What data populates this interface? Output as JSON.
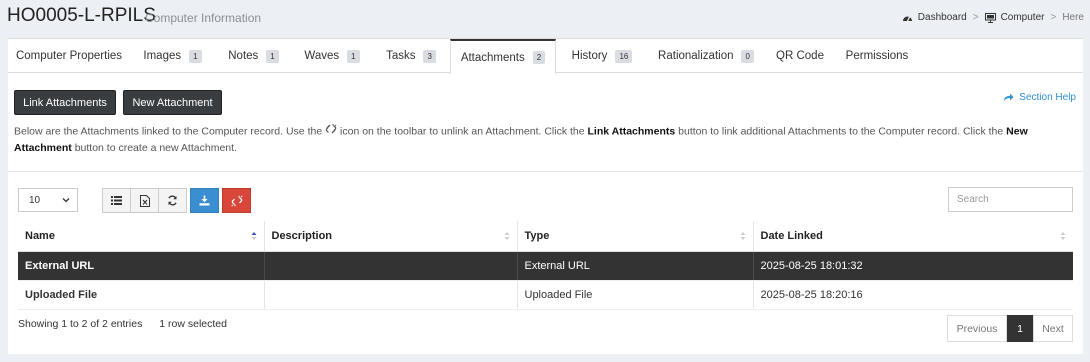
{
  "header": {
    "title": "HO0005-L-RPILS",
    "subtitle": "Computer Information",
    "breadcrumb": {
      "dashboard": "Dashboard",
      "computer": "Computer",
      "here": "Here"
    }
  },
  "tabs": [
    {
      "label": "Computer Properties",
      "count": null
    },
    {
      "label": "Images",
      "count": "1"
    },
    {
      "label": "Notes",
      "count": "1"
    },
    {
      "label": "Waves",
      "count": "1"
    },
    {
      "label": "Tasks",
      "count": "3"
    },
    {
      "label": "Attachments",
      "count": "2",
      "active": true
    },
    {
      "label": "History",
      "count": "16"
    },
    {
      "label": "Rationalization",
      "count": "0"
    },
    {
      "label": "QR Code",
      "count": null
    },
    {
      "label": "Permissions",
      "count": null
    }
  ],
  "actions": {
    "link": "Link Attachments",
    "new": "New Attachment",
    "help": "Section Help"
  },
  "intro": {
    "p1": "Below are the Attachments linked to the Computer record. Use the",
    "p2": "icon on the toolbar to unlink an Attachment. Click the",
    "b1": "Link Attachments",
    "p3": "button to link additional Attachments to the Computer record. Click the",
    "b2": "New Attachment",
    "p4": "button to create a new Attachment."
  },
  "toolbar": {
    "page_length": "10",
    "search_placeholder": "Search"
  },
  "table": {
    "columns": [
      "Name",
      "Description",
      "Type",
      "Date Linked"
    ],
    "rows": [
      {
        "name": "External URL",
        "description": "",
        "type": "External URL",
        "date": "2025-08-25 18:01:32",
        "selected": true
      },
      {
        "name": "Uploaded File",
        "description": "",
        "type": "Uploaded File",
        "date": "2025-08-25 18:20:16",
        "selected": false
      }
    ]
  },
  "footer": {
    "showing": "Showing 1 to 2 of 2 entries",
    "selected": "1 row selected"
  },
  "pagination": {
    "prev": "Previous",
    "current": "1",
    "next": "Next"
  },
  "colors": {
    "accent": "#2d8fd5",
    "dark": "#333333",
    "export": "#3b8fd0",
    "unlink": "#d8473a"
  }
}
